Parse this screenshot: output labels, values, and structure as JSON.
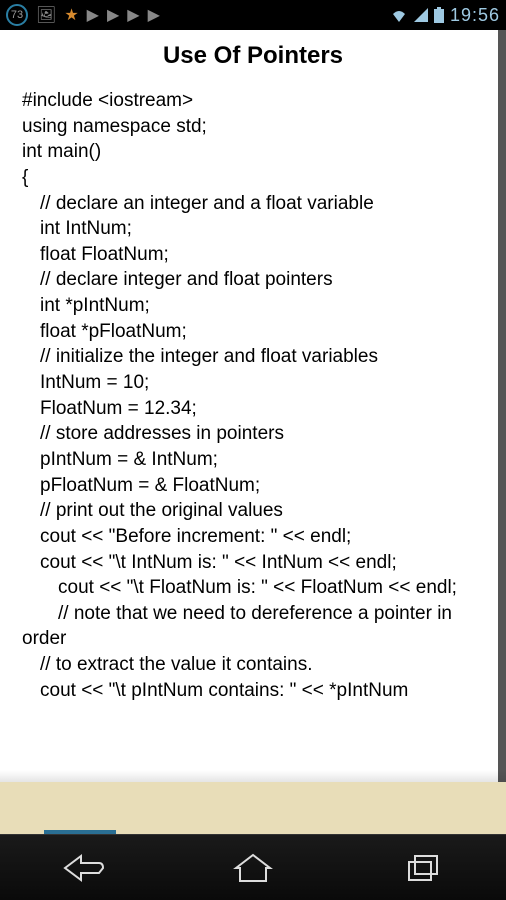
{
  "statusBar": {
    "notificationCount": "73",
    "time": "19:56"
  },
  "page": {
    "title": "Use Of Pointers"
  },
  "code": [
    {
      "indent": "l0",
      "text": "#include <iostream>"
    },
    {
      "indent": "l0",
      "text": "using namespace std;"
    },
    {
      "indent": "l0",
      "text": "int main()"
    },
    {
      "indent": "l0",
      "text": "{"
    },
    {
      "indent": "l1",
      "text": "// declare an integer and a float variable"
    },
    {
      "indent": "l1",
      "text": "int IntNum;"
    },
    {
      "indent": "l1",
      "text": "float FloatNum;"
    },
    {
      "indent": "l1",
      "text": "// declare integer and float pointers"
    },
    {
      "indent": "l1",
      "text": "int *pIntNum;"
    },
    {
      "indent": "l1",
      "text": "float *pFloatNum;"
    },
    {
      "indent": "l1",
      "text": "// initialize the integer and float variables"
    },
    {
      "indent": "l1",
      "text": "IntNum = 10;"
    },
    {
      "indent": "l1",
      "text": "FloatNum = 12.34;"
    },
    {
      "indent": "l1",
      "text": "// store addresses in pointers"
    },
    {
      "indent": "l1",
      "text": "pIntNum = & IntNum;"
    },
    {
      "indent": "l1",
      "text": "pFloatNum = & FloatNum;"
    },
    {
      "indent": "l1",
      "text": "// print out the original values"
    },
    {
      "indent": "l1",
      "text": "cout << \"Before increment: \" << endl;"
    },
    {
      "indent": "l1",
      "text": "cout << \"\\t IntNum is: \" << IntNum << endl;"
    },
    {
      "indent": "l2",
      "text": "cout << \"\\t FloatNum is: \" << FloatNum << endl;"
    },
    {
      "indent": "l2",
      "text": "// note that we need to dereference a pointer in order"
    },
    {
      "indent": "l1",
      "text": "// to extract the value it contains."
    },
    {
      "indent": "l1",
      "text": "cout << \"\\t pIntNum contains: \" << *pIntNum"
    }
  ]
}
